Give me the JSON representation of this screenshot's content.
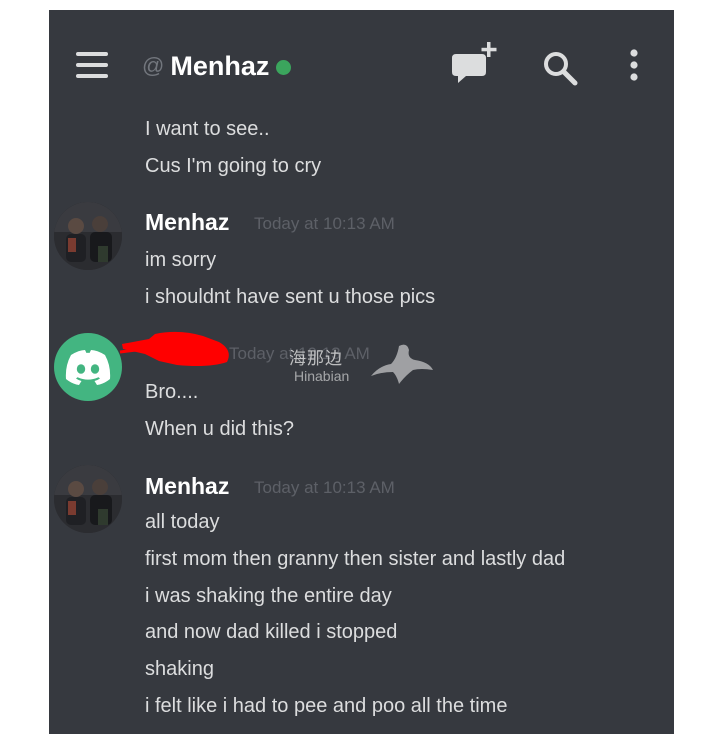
{
  "header": {
    "at_symbol": "@",
    "channel_name": "Menhaz",
    "online_color": "#3ba55d",
    "icons": [
      "menu-icon",
      "new-chat-icon",
      "search-icon",
      "more-options-icon"
    ]
  },
  "messages": {
    "group0": {
      "lines": [
        "I want to see..",
        "Cus I'm going to cry"
      ]
    },
    "group1": {
      "author": "Menhaz",
      "timestamp": "Today at 10:13 AM",
      "lines": [
        "im sorry",
        "i shouldnt have sent u those pics"
      ]
    },
    "group2": {
      "timestamp": "Today at 10:13 AM",
      "lines": [
        "Bro....",
        "When u did this?"
      ]
    },
    "group3": {
      "author": "Menhaz",
      "timestamp": "Today at 10:13 AM",
      "lines": [
        "all today",
        "first mom then granny then sister and lastly dad",
        "i was shaking the entire day",
        "and now dad killed i stopped",
        "shaking",
        "i felt like i had to pee and poo all the time"
      ]
    }
  },
  "watermark": {
    "chinese": "海那边",
    "latin": "Hinabian"
  },
  "colors": {
    "background": "#36393f",
    "discord_green": "#43b581",
    "redaction": "#ff0000"
  }
}
